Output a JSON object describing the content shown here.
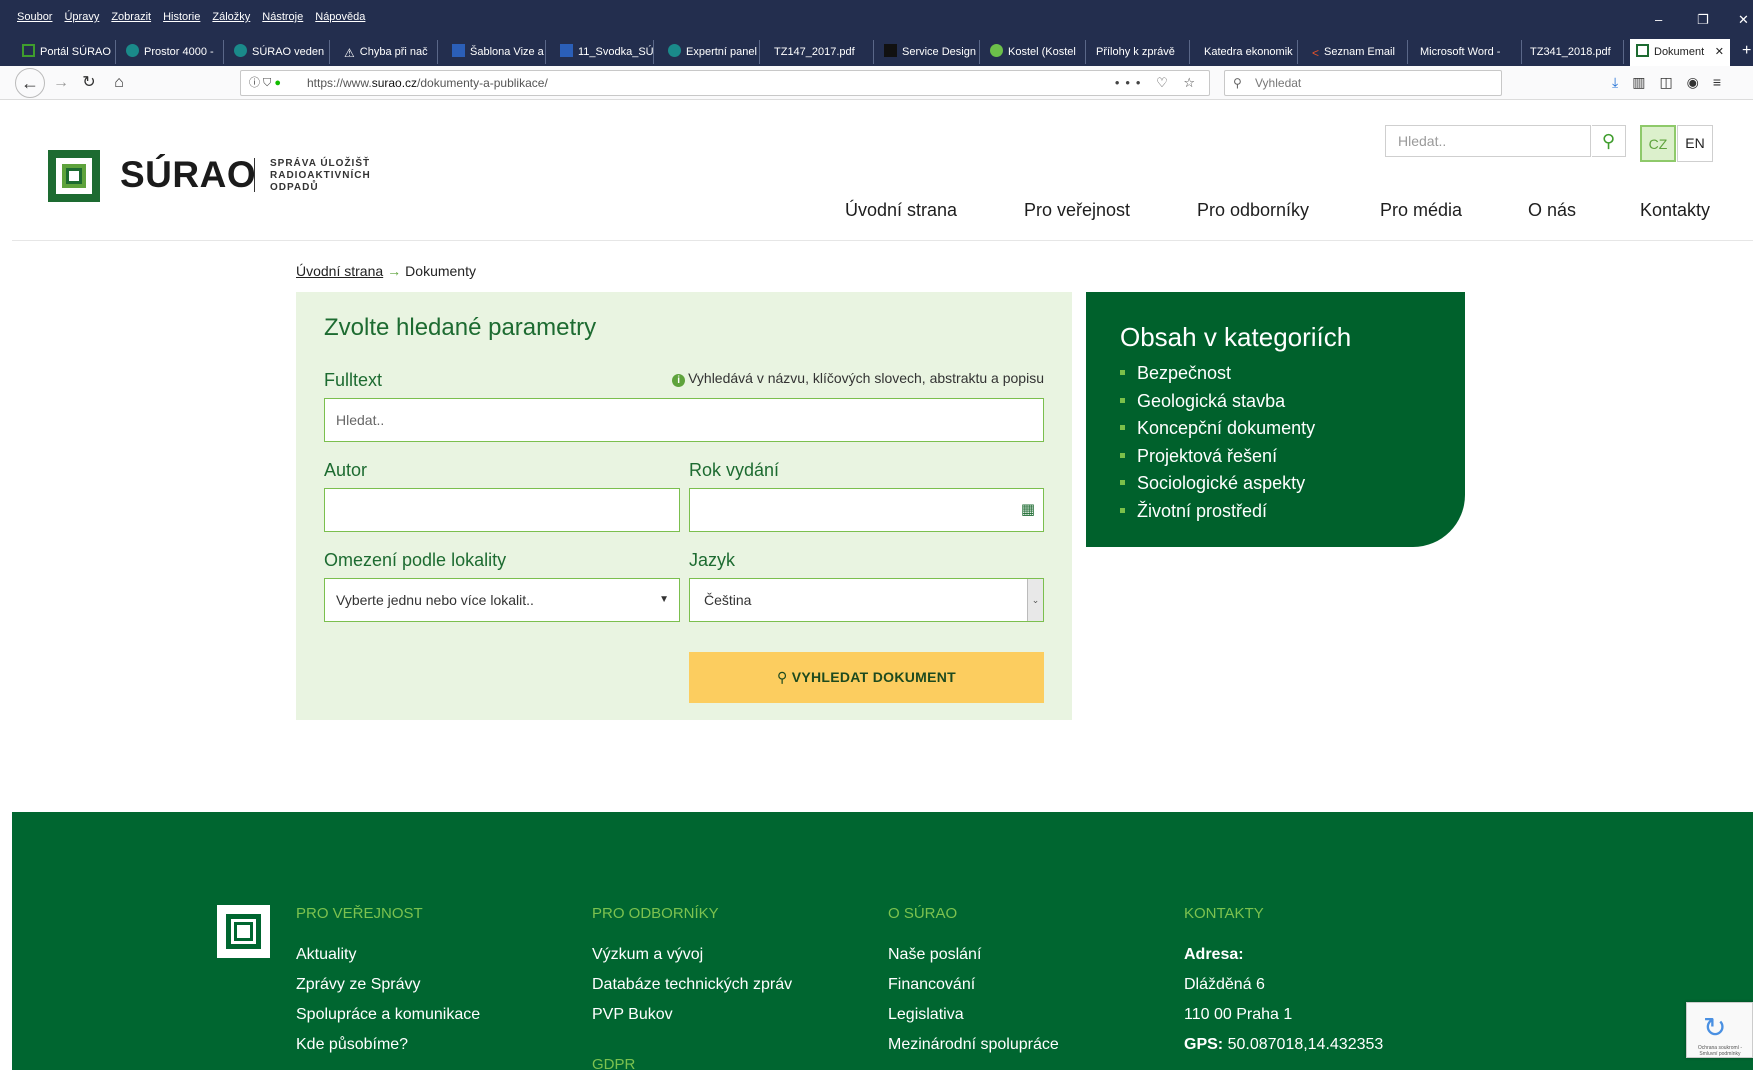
{
  "browser": {
    "menu": [
      "Soubor",
      "Úpravy",
      "Zobrazit",
      "Historie",
      "Záložky",
      "Nástroje",
      "Nápověda"
    ],
    "window_controls": {
      "minimize": "–",
      "restore": "❐",
      "close": "✕"
    },
    "tabs": [
      {
        "label": "Portál SÚRAO",
        "icon_color": "#3f9d2d"
      },
      {
        "label": "Prostor 4000 -",
        "icon_color": "#1a8a8a"
      },
      {
        "label": "SÚRAO veden",
        "icon_color": "#1a8a8a"
      },
      {
        "label": "Chyba při nač",
        "icon_color": "#ffffff"
      },
      {
        "label": "Šablona Vize a",
        "icon_color": "#2b5fb8"
      },
      {
        "label": "11_Svodka_SÚ",
        "icon_color": "#2b5fb8"
      },
      {
        "label": "Expertní panel",
        "icon_color": "#1a8a8a"
      },
      {
        "label": "TZ147_2017.pdf",
        "icon_color": ""
      },
      {
        "label": "Service Design",
        "icon_color": "#111111"
      },
      {
        "label": "Kostel (Kostel",
        "icon_color": "#6cc04a"
      },
      {
        "label": "Přílohy k zprávě",
        "icon_color": ""
      },
      {
        "label": "Katedra ekonomik",
        "icon_color": ""
      },
      {
        "label": "Seznam Email",
        "icon_color": "#e4522a"
      },
      {
        "label": "Microsoft Word -",
        "icon_color": ""
      },
      {
        "label": "TZ341_2018.pdf",
        "icon_color": ""
      },
      {
        "label": "Dokument",
        "icon_color": "#1d6b31",
        "active": true
      }
    ],
    "url_prefix": "https://www.",
    "url_domain": "surao.cz",
    "url_path": "/dokumenty-a-publikace/",
    "url_actions": "••• ♡ ☆",
    "search_placeholder": "Vyhledat"
  },
  "site": {
    "logo_text": "SÚRAO",
    "logo_sub": [
      "SPRÁVA ÚLOŽIŠŤ",
      "RADIOAKTIVNÍCH",
      "ODPADŮ"
    ],
    "header_search_placeholder": "Hledat..",
    "lang_cz": "CZ",
    "lang_en": "EN",
    "nav": [
      "Úvodní strana",
      "Pro veřejnost",
      "Pro odborníky",
      "Pro média",
      "O nás",
      "Kontakty"
    ],
    "brand_green": "#1d6b31",
    "accent_green": "#5ea33c"
  },
  "breadcrumb": {
    "home": "Úvodní strana",
    "arrow": "→",
    "current": "Dokumenty"
  },
  "search_panel": {
    "title": "Zvolte hledané parametry",
    "fulltext_label": "Fulltext",
    "fulltext_hint": "Vyhledává v názvu, klíčových slovech, abstraktu a popisu",
    "fulltext_placeholder": "Hledat..",
    "author_label": "Autor",
    "author_value": "",
    "year_label": "Rok vydání",
    "year_value": "",
    "locality_label": "Omezení podle lokality",
    "locality_placeholder": "Vyberte jednu nebo více lokalit..",
    "language_label": "Jazyk",
    "language_value": "Čeština",
    "search_button": "VYHLEDAT DOKUMENT"
  },
  "categories": {
    "title": "Obsah v kategoriích",
    "items": [
      "Bezpečnost",
      "Geologická stavba",
      "Koncepční dokumenty",
      "Projektová řešení",
      "Sociologické aspekty",
      "Životní prostředí"
    ]
  },
  "footer": {
    "columns": [
      {
        "heading": "PRO VEŘEJNOST",
        "links": [
          "Aktuality",
          "Zprávy ze Správy",
          "Spolupráce a komunikace",
          "Kde působíme?"
        ]
      },
      {
        "heading": "PRO ODBORNÍKY",
        "links": [
          "Výzkum a vývoj",
          "Databáze technických zpráv",
          "PVP Bukov"
        ]
      },
      {
        "heading": "O SÚRAO",
        "links": [
          "Naše poslání",
          "Financování",
          "Legislativa",
          "Mezinárodní spolupráce"
        ]
      },
      {
        "heading": "KONTAKTY",
        "address_label": "Adresa:",
        "address_lines": [
          "Dlážděná 6",
          "110 00 Praha 1"
        ],
        "gps_label": "GPS:",
        "gps_value": "50.087018,14.432353"
      }
    ],
    "gdpr": "GDPR"
  },
  "recaptcha": {
    "text": "Ochrana soukromí - Smluvní podmínky"
  }
}
